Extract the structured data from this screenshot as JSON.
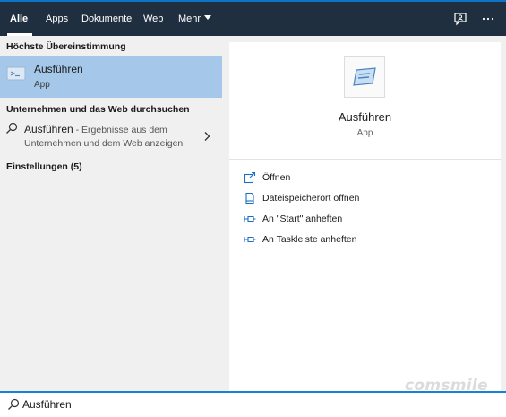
{
  "tabs": [
    {
      "label": "Alle",
      "active": true
    },
    {
      "label": "Apps"
    },
    {
      "label": "Dokumente"
    },
    {
      "label": "Web"
    },
    {
      "label": "Mehr"
    }
  ],
  "toolbar": {
    "feedback_icon": "feedback-icon",
    "more_icon": "ellipsis-icon"
  },
  "left": {
    "best_match_title": "Höchste Übereinstimmung",
    "best_match": {
      "name": "Ausführen",
      "type": "App",
      "icon": "run-app-icon"
    },
    "web_title": "Unternehmen und das Web durchsuchen",
    "web_item": {
      "name": "Ausführen",
      "suffix": " - Ergebnisse aus dem Unternehmen und dem Web anzeigen"
    },
    "settings_title": "Einstellungen (5)"
  },
  "right": {
    "name": "Ausführen",
    "type": "App",
    "actions": [
      {
        "label": "Öffnen",
        "icon": "open-icon"
      },
      {
        "label": "Dateispeicherort öffnen",
        "icon": "file-location-icon"
      },
      {
        "label": "An \"Start\" anheften",
        "icon": "pin-icon"
      },
      {
        "label": "An Taskleiste anheften",
        "icon": "pin-icon"
      }
    ]
  },
  "search": {
    "value": "Ausführen"
  },
  "watermark": "comsmile",
  "colors": {
    "topbar": "#1f2f3f",
    "accent": "#1783d4",
    "selected": "#a5c8ea",
    "link_icon": "#1a6fc4"
  }
}
